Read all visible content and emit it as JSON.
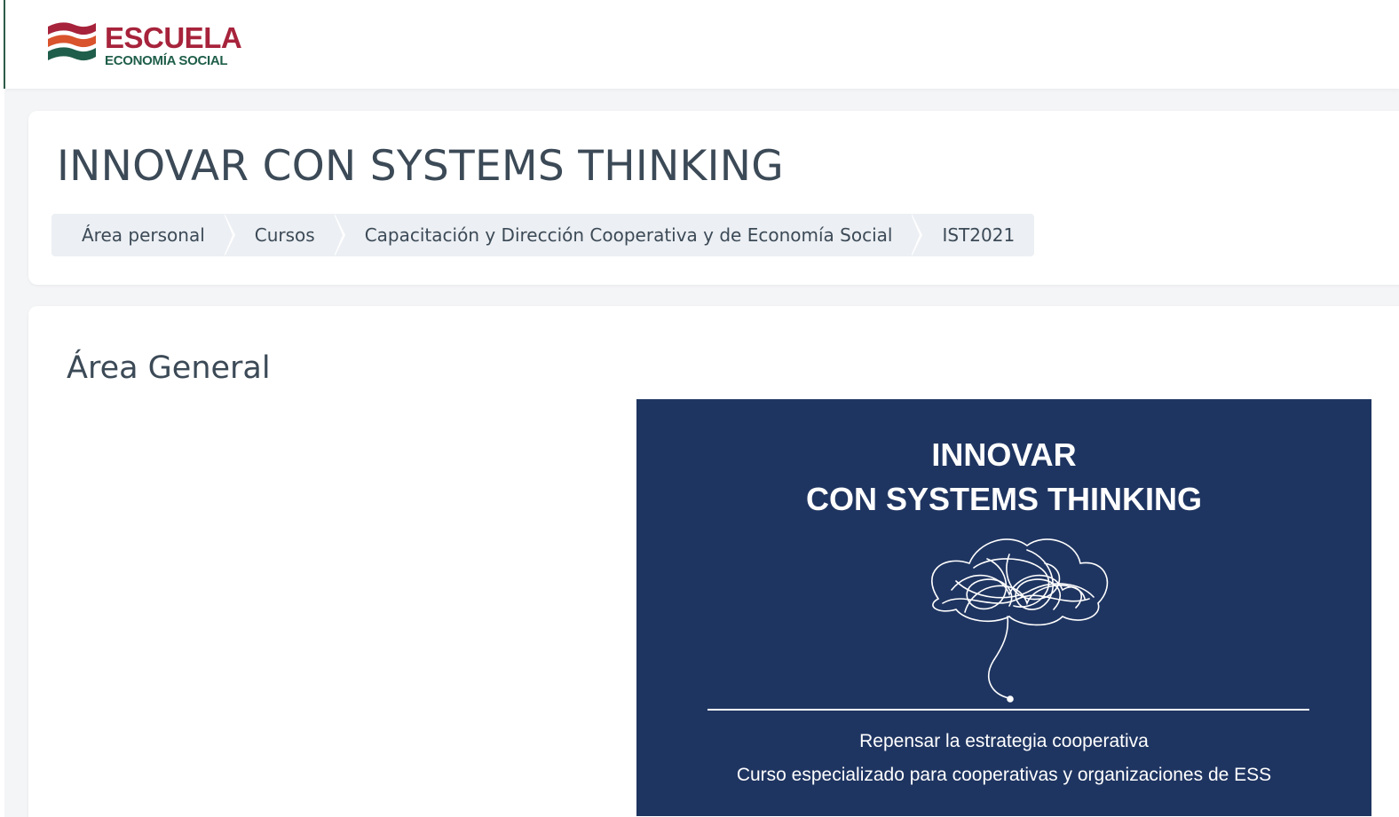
{
  "brand": {
    "name": "ESCUELA",
    "subtitle": "ECONOMÍA SOCIAL",
    "colors": {
      "red": "#a7233b",
      "orange": "#d9532c",
      "green": "#1f5e4a"
    }
  },
  "header": {
    "title": "INNOVAR CON SYSTEMS THINKING",
    "breadcrumb": [
      {
        "label": "Área personal"
      },
      {
        "label": "Cursos"
      },
      {
        "label": "Capacitación y Dirección Cooperativa y de Economía Social"
      },
      {
        "label": "IST2021"
      }
    ]
  },
  "section": {
    "title": "Área General"
  },
  "banner": {
    "title_line1": "INNOVAR",
    "title_line2": "CON SYSTEMS THINKING",
    "subtitle_line1": "Repensar la estrategia cooperativa",
    "subtitle_line2": "Curso especializado para cooperativas y organizaciones de ESS",
    "background": "#1f3561",
    "illustration": "tangled-tree-icon"
  }
}
